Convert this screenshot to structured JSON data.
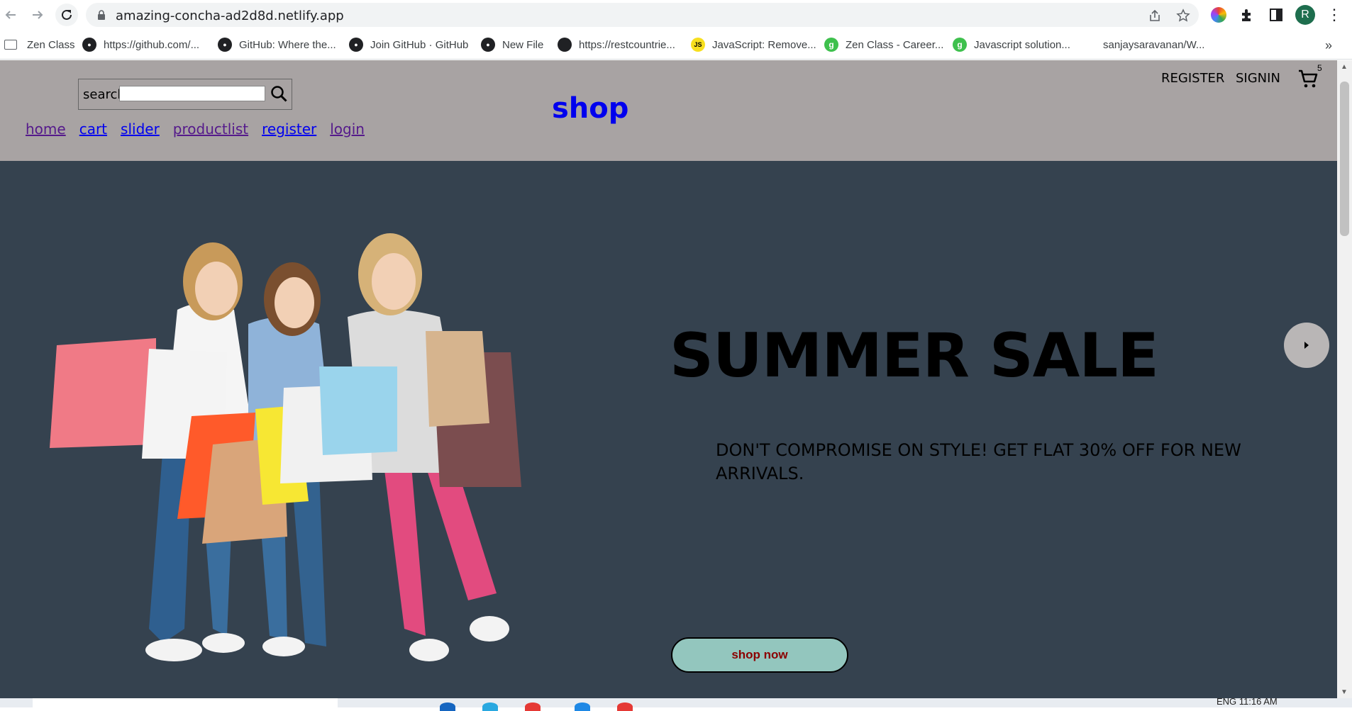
{
  "browser": {
    "url": "amazing-concha-ad2d8d.netlify.app",
    "profile_initial": "R",
    "bookmarks": [
      {
        "label": "Zen Class",
        "icon": "zen-class-icon"
      },
      {
        "label": "https://github.com/...",
        "icon": "github-icon"
      },
      {
        "label": "GitHub: Where the...",
        "icon": "github-icon"
      },
      {
        "label": "Join GitHub · GitHub",
        "icon": "github-icon"
      },
      {
        "label": "New File",
        "icon": "github-icon"
      },
      {
        "label": "https://restcountrie...",
        "icon": "globe-icon"
      },
      {
        "label": "JavaScript: Remove...",
        "icon": "js-icon"
      },
      {
        "label": "Zen Class - Career...",
        "icon": "zen-icon"
      },
      {
        "label": "Javascript solution...",
        "icon": "zen-icon"
      },
      {
        "label": "sanjaysaravanan/W...",
        "icon": "none"
      }
    ],
    "more_bookmarks": "»"
  },
  "site": {
    "search_label": "search",
    "brand": "shop",
    "nav": [
      "home",
      "cart",
      "slider",
      "productlist",
      "register",
      "login"
    ],
    "register_link": "REGISTER",
    "signin_link": "SIGNIN",
    "cart_count": "5"
  },
  "hero": {
    "title": "SUMMER SALE",
    "description": "DON'T COMPROMISE ON STYLE! GET FLAT 30% OFF FOR NEW ARRIVALS.",
    "button": "shop now"
  },
  "taskbar": {
    "tray_text": "ENG   11:16 AM"
  },
  "colors": {
    "header_bg": "#a8a3a3",
    "hero_bg": "#35424f",
    "brand": "#0000ee",
    "button_bg": "#93c6be",
    "button_text": "#8b0000"
  }
}
